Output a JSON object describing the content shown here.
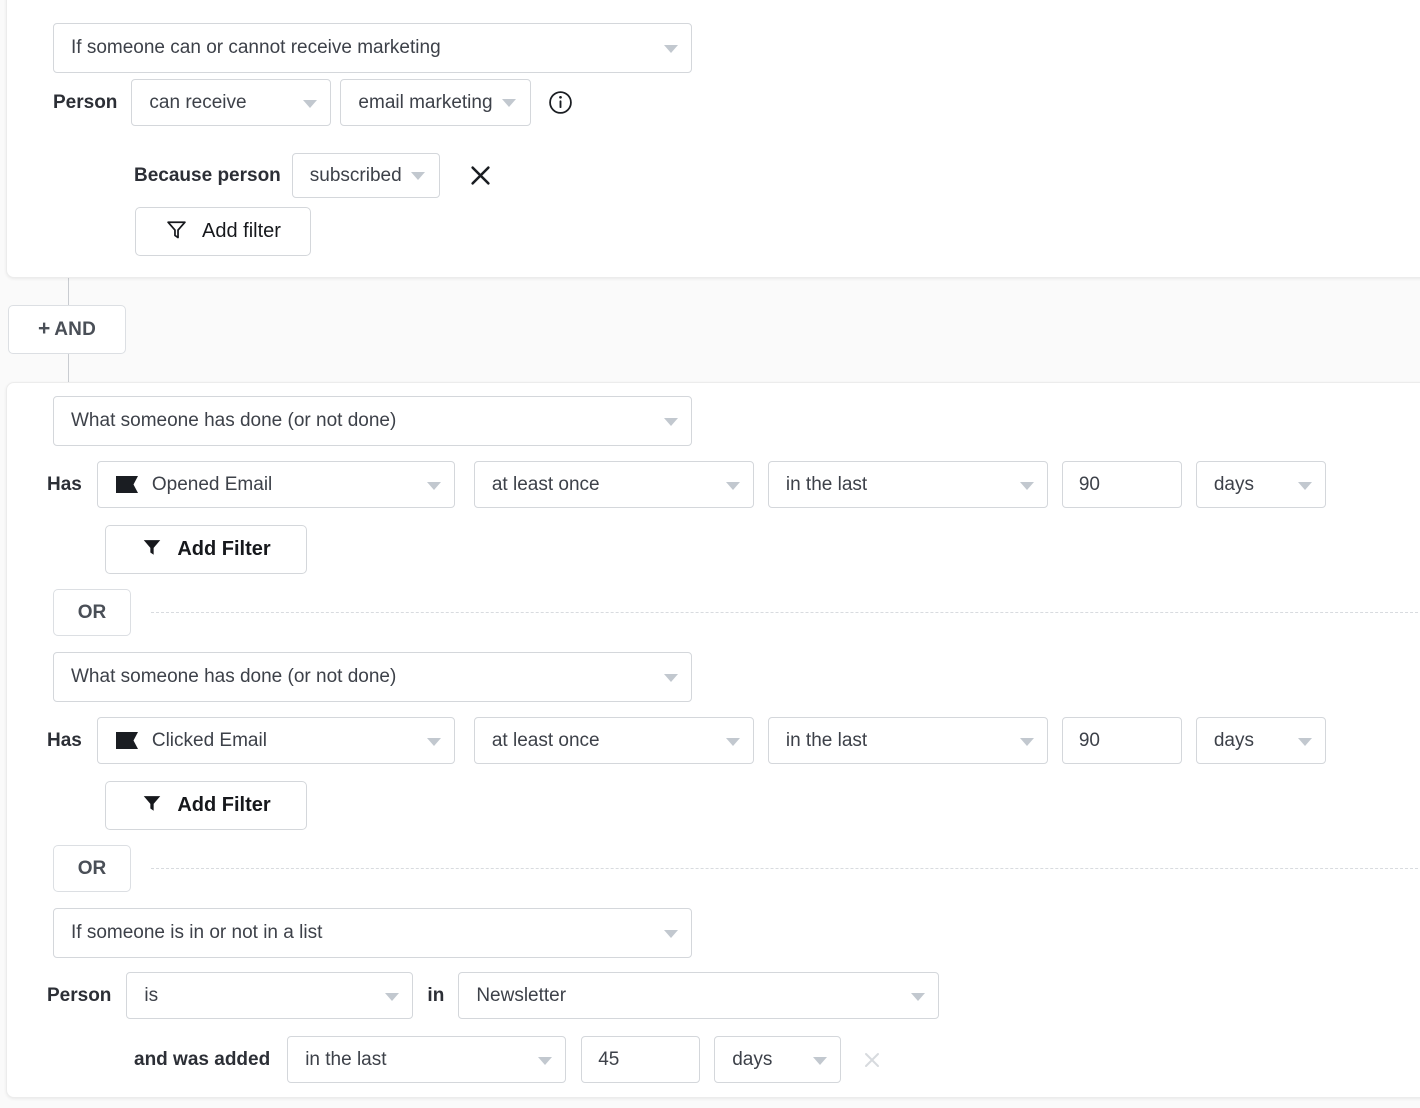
{
  "groups": [
    {
      "id": "group-marketing",
      "type_select": {
        "value": "If someone can or cannot receive marketing",
        "icon": "chevron-down-icon"
      },
      "rows": [
        {
          "label": "Person",
          "fields": [
            {
              "kind": "select",
              "value": "can receive"
            },
            {
              "kind": "select",
              "value": "email marketing"
            }
          ],
          "info_icon": "info-icon"
        },
        {
          "label": "Because person",
          "fields": [
            {
              "kind": "select",
              "value": "subscribed"
            }
          ],
          "remove_icon": "close-icon"
        }
      ],
      "add_filter": {
        "label": "Add filter",
        "icon": "filter-outline-icon"
      }
    },
    {
      "id": "group-behavior",
      "blocks": [
        {
          "type_select": {
            "value": "What someone has done (or not done)"
          },
          "label": "Has",
          "metric": {
            "value": "Opened Email",
            "icon": "flag-icon"
          },
          "frequency": "at least once",
          "timeframe": "in the last",
          "amount": "90",
          "unit": "days",
          "add_filter": {
            "label": "Add Filter",
            "icon": "filter-solid-icon"
          }
        },
        {
          "divider": "OR"
        },
        {
          "type_select": {
            "value": "What someone has done (or not done)"
          },
          "label": "Has",
          "metric": {
            "value": "Clicked Email",
            "icon": "flag-icon"
          },
          "frequency": "at least once",
          "timeframe": "in the last",
          "amount": "90",
          "unit": "days",
          "add_filter": {
            "label": "Add Filter",
            "icon": "filter-solid-icon"
          }
        },
        {
          "divider": "OR"
        },
        {
          "type_select": {
            "value": "If someone is in or not in a list"
          },
          "label": "Person",
          "operator": "is",
          "preposition": "in",
          "list": "Newsletter",
          "sub_label": "and was added",
          "timeframe": "in the last",
          "amount": "45",
          "unit": "days",
          "remove_icon": "close-icon"
        }
      ]
    }
  ],
  "and_button": {
    "plus": "+",
    "label": "AND"
  },
  "colors": {
    "page_bg": "#fafafa",
    "panel_bg": "#ffffff",
    "border": "#d4d7db",
    "text": "#3d4149",
    "label": "#2c2f36",
    "caret": "#c2c8cf",
    "dashed": "#d8dbdf",
    "disabled": "#d7dade"
  }
}
